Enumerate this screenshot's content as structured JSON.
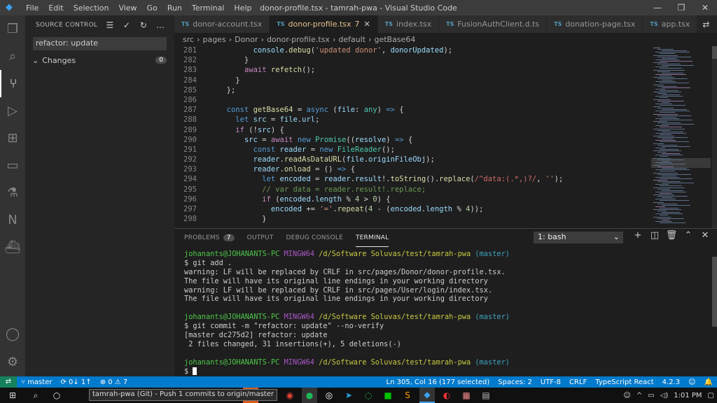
{
  "window": {
    "title": "donor-profile.tsx - tamrah-pwa - Visual Studio Code",
    "menu": [
      "File",
      "Edit",
      "Selection",
      "View",
      "Go",
      "Run",
      "Terminal",
      "Help"
    ]
  },
  "sidebar": {
    "title": "SOURCE CONTROL",
    "commit_message": "refactor: update",
    "changes_label": "Changes",
    "changes_count": "0"
  },
  "tabs": [
    {
      "label": "donor-account.tsx",
      "active": false
    },
    {
      "label": "donor-profile.tsx",
      "count": "7",
      "active": true
    },
    {
      "label": "index.tsx",
      "active": false
    },
    {
      "label": "FusionAuthClient.d.ts",
      "active": false
    },
    {
      "label": "donation-page.tsx",
      "active": false
    },
    {
      "label": "app.tsx",
      "active": false
    }
  ],
  "breadcrumbs": [
    "src",
    "pages",
    "Donor",
    "donor-profile.tsx",
    "default",
    "getBase64"
  ],
  "editor_lines": [
    {
      "n": "281",
      "html": "        <span class='var'>console</span>.<span class='fn'>debug</span>(<span class='str'>'updated donor'</span>, <span class='var'>donorUpdated</span>);"
    },
    {
      "n": "282",
      "html": "      }"
    },
    {
      "n": "283",
      "html": "      <span class='ctl'>await</span> <span class='fn'>refetch</span>();"
    },
    {
      "n": "284",
      "html": "    }"
    },
    {
      "n": "285",
      "html": "  };"
    },
    {
      "n": "286",
      "html": ""
    },
    {
      "n": "287",
      "html": "  <span class='kw'>const</span> <span class='fn'>getBase64</span> = <span class='kw'>async</span> (<span class='var'>file</span>: <span class='cls'>any</span>) <span class='kw'>=&gt;</span> {"
    },
    {
      "n": "288",
      "html": "    <span class='kw'>let</span> <span class='var'>src</span> = <span class='var'>file</span>.<span class='var'>url</span>;"
    },
    {
      "n": "289",
      "html": "    <span class='ctl'>if</span> (!<span class='var'>src</span>) {"
    },
    {
      "n": "290",
      "html": "      <span class='var'>src</span> = <span class='ctl'>await</span> <span class='kw'>new</span> <span class='cls'>Promise</span>((<span class='var'>resolve</span>) <span class='kw'>=&gt;</span> {"
    },
    {
      "n": "291",
      "html": "        <span class='kw'>const</span> <span class='var'>reader</span> = <span class='kw'>new</span> <span class='cls'>FileReader</span>();"
    },
    {
      "n": "292",
      "html": "        <span class='var'>reader</span>.<span class='fn'>readAsDataURL</span>(<span class='var'>file</span>.<span class='var'>originFileObj</span>);"
    },
    {
      "n": "293",
      "html": "        <span class='var'>reader</span>.<span class='fn'>onload</span> = () <span class='kw'>=&gt;</span> {"
    },
    {
      "n": "294",
      "html": "          <span class='kw'>let</span> <span class='var'>encoded</span> = <span class='var'>reader</span>.<span class='var'>result</span>!.<span class='fn'>toString</span>().<span class='fn'>replace</span>(<span class='rx'>/^data:(.*,)?/</span>, <span class='str'>''</span>);"
    },
    {
      "n": "295",
      "html": "          <span class='cmt'>// var data = reader.result!.replace;</span>"
    },
    {
      "n": "296",
      "html": "          <span class='ctl'>if</span> (<span class='var'>encoded</span>.<span class='var'>length</span> % <span class='num'>4</span> &gt; <span class='num'>0</span>) {"
    },
    {
      "n": "297",
      "html": "            <span class='var'>encoded</span> += <span class='str'>'='</span>.<span class='fn'>repeat</span>(<span class='num'>4</span> - (<span class='var'>encoded</span>.<span class='var'>length</span> % <span class='num'>4</span>));"
    },
    {
      "n": "298",
      "html": "          }"
    }
  ],
  "panel": {
    "tabs": [
      {
        "label": "PROBLEMS",
        "badge": "7"
      },
      {
        "label": "OUTPUT"
      },
      {
        "label": "DEBUG CONSOLE"
      },
      {
        "label": "TERMINAL",
        "active": true
      }
    ],
    "shell_select": "1: bash"
  },
  "terminal": [
    {
      "type": "prompt",
      "user": "johanants@JOHANANTS-PC",
      "env": "MINGW64",
      "path": "/d/Software Soluvas/test/tamrah-pwa",
      "branch": "(master)"
    },
    {
      "type": "text",
      "text": "$ git add ."
    },
    {
      "type": "text",
      "text": "warning: LF will be replaced by CRLF in src/pages/Donor/donor-profile.tsx."
    },
    {
      "type": "text",
      "text": "The file will have its original line endings in your working directory"
    },
    {
      "type": "text",
      "text": "warning: LF will be replaced by CRLF in src/pages/User/login/index.tsx."
    },
    {
      "type": "text",
      "text": "The file will have its original line endings in your working directory"
    },
    {
      "type": "text",
      "text": ""
    },
    {
      "type": "prompt",
      "user": "johanants@JOHANANTS-PC",
      "env": "MINGW64",
      "path": "/d/Software Soluvas/test/tamrah-pwa",
      "branch": "(master)"
    },
    {
      "type": "text",
      "text": "$ git commit -m \"refactor: update\" --no-verify"
    },
    {
      "type": "text",
      "text": "[master dc275d2] refactor: update"
    },
    {
      "type": "text",
      "text": " 2 files changed, 31 insertions(+), 5 deletions(-)"
    },
    {
      "type": "text",
      "text": ""
    },
    {
      "type": "prompt",
      "user": "johanants@JOHANANTS-PC",
      "env": "MINGW64",
      "path": "/d/Software Soluvas/test/tamrah-pwa",
      "branch": "(master)"
    },
    {
      "type": "cursor",
      "text": "$ "
    }
  ],
  "status": {
    "branch": "master",
    "sync": "0↓ 1↑",
    "problems": "⊗ 0 ⚠ 7",
    "position": "Ln 305, Col 16 (177 selected)",
    "spaces": "Spaces: 2",
    "encoding": "UTF-8",
    "eol": "CRLF",
    "language": "TypeScript React",
    "version": "4.2.3"
  },
  "taskbar": {
    "tooltip": "tamrah-pwa (Git) - Push 1 commits to origin/master",
    "time": "1:01 PM"
  }
}
